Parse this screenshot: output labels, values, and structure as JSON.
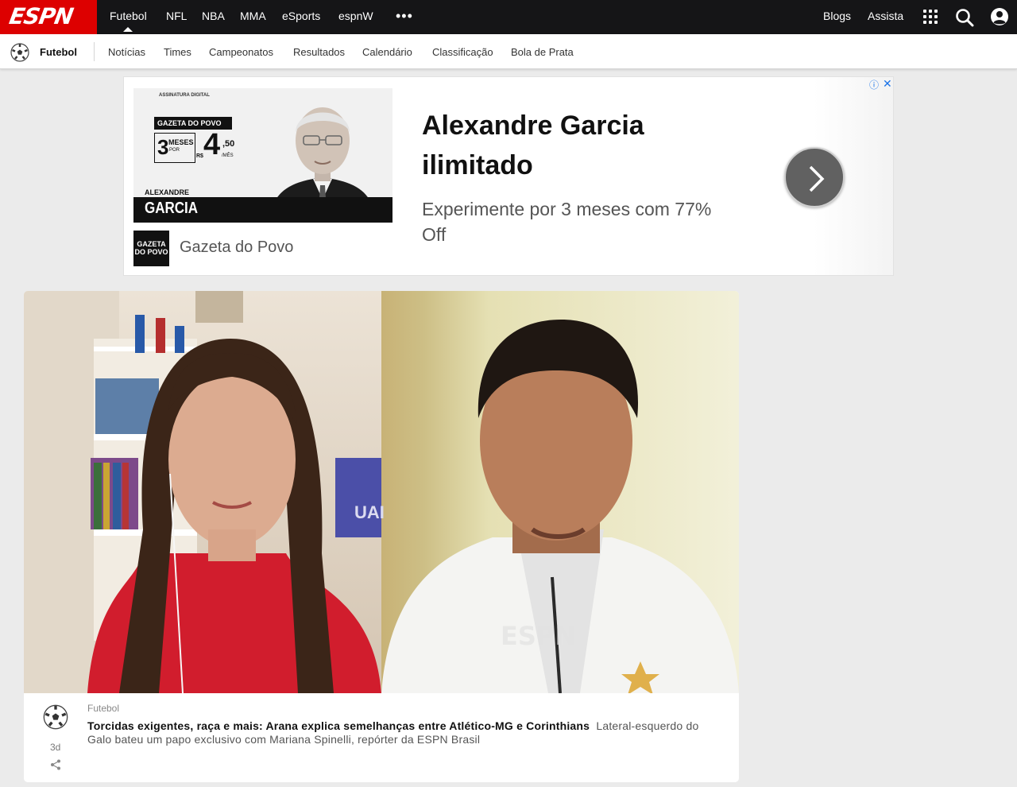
{
  "topnav": {
    "logo": "ESPN",
    "items": [
      "Futebol",
      "NFL",
      "NBA",
      "MMA",
      "eSports",
      "espnW"
    ],
    "more": "•••",
    "right": [
      "Blogs",
      "Assista"
    ]
  },
  "subnav": {
    "section": "Futebol",
    "items": [
      "Notícias",
      "Times",
      "Campeonatos",
      "Resultados",
      "Calendário",
      "Classificação",
      "Bola de Prata"
    ]
  },
  "ad": {
    "image": {
      "subtitle": "ASSINATURA DIGITAL",
      "paper": "GAZETA DO POVO",
      "offer_number": "3",
      "offer_unit": "MESES",
      "offer_por": "POR",
      "currency": "R$",
      "price": "4",
      "price_cents": ",50",
      "price_unit": "/MÊS",
      "first_name": "ALEXANDRE",
      "last_name": "GARCIA"
    },
    "brand_logo": "GAZETA DO POVO",
    "brand": "Gazeta do Povo",
    "headline": "Alexandre Garcia ilimitado",
    "body": "Experimente por 3 meses com 77% Off",
    "info": "ⓘ",
    "close": "✕"
  },
  "card": {
    "category": "Futebol",
    "headline": "Torcidas exigentes, raça e mais: Arana explica semelhanças entre Atlético-MG e Corinthians",
    "description": "Lateral-esquerdo do Galo bateu um papo exclusivo com Mariana Spinelli, repórter da ESPN Brasil",
    "time": "3d",
    "video_labels": {
      "sign": "UAI",
      "watermark": "ESPN"
    }
  }
}
